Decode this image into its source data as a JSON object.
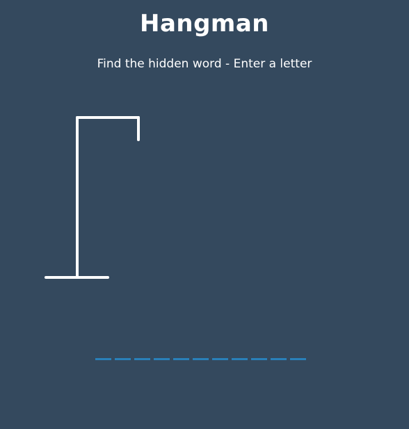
{
  "game": {
    "title": "Hangman",
    "subtitle": "Find the hidden word - Enter a letter"
  },
  "colors": {
    "background": "#34495e",
    "figure": "#ffffff",
    "letter_slot": "#2980b9"
  },
  "word": {
    "slots": [
      "",
      "",
      "",
      "",
      "",
      "",
      "",
      "",
      "",
      "",
      ""
    ]
  }
}
